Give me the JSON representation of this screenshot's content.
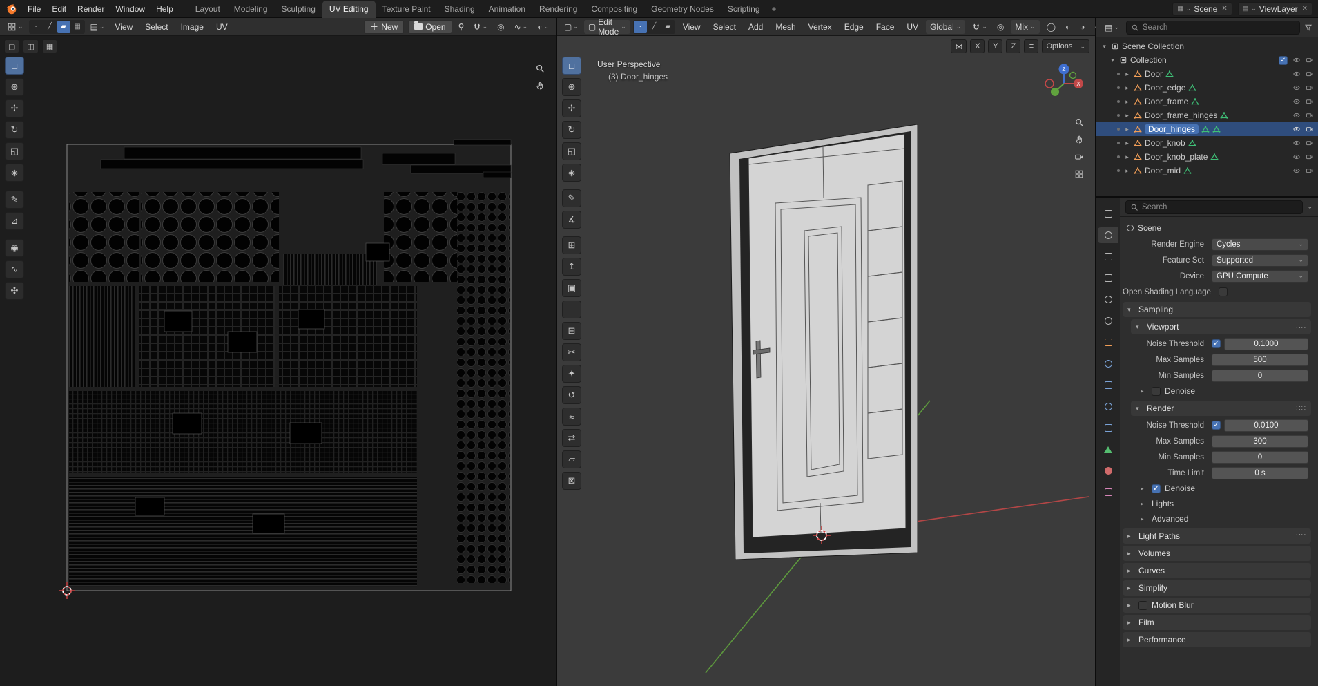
{
  "icons": {
    "caret": "⌄",
    "chevron_right": "▸",
    "chevron_down": "▾",
    "close": "✕",
    "plus": "＋",
    "grip": "∷∷",
    "cube": "▢",
    "proportional": "◎",
    "falloff": "∿",
    "overlay": "◐",
    "grid": "▦",
    "layers": "▤",
    "mirror": "⋈",
    "tool_options": "≡",
    "shading": [
      "◯",
      "◐",
      "◑",
      "●"
    ]
  },
  "colors": {
    "accent": "#4772b3",
    "selected_row": "#2f4d7d",
    "mesh_icon": "#ef9d57",
    "data_icon": "#3fbf77",
    "axis_x": "#c24848",
    "axis_y": "#61a33e",
    "axis_z": "#3f6fd0"
  },
  "topbar": {
    "menus": [
      "File",
      "Edit",
      "Render",
      "Window",
      "Help"
    ],
    "tabs": [
      "Layout",
      "Modeling",
      "Sculpting",
      "UV Editing",
      "Texture Paint",
      "Shading",
      "Animation",
      "Rendering",
      "Compositing",
      "Geometry Nodes",
      "Scripting"
    ],
    "active_tab": "UV Editing",
    "add_tab_label": "+",
    "scene_selector": {
      "label": "Scene"
    },
    "viewlayer_selector": {
      "label": "ViewLayer"
    }
  },
  "uv_editor": {
    "menus": [
      "View",
      "Select",
      "Image",
      "UV"
    ],
    "new_button_label": "New",
    "open_button_label": "Open",
    "mode_icons": [
      "∙",
      "╱",
      "▰",
      "▦"
    ],
    "settings_icons": [
      "▢",
      "◫",
      "▦"
    ],
    "tools": [
      {
        "name": "select-box",
        "glyph": "□"
      },
      {
        "name": "cursor",
        "glyph": "⊕"
      },
      {
        "name": "move",
        "glyph": "✢"
      },
      {
        "name": "rotate",
        "glyph": "↻"
      },
      {
        "name": "scale",
        "glyph": "◱"
      },
      {
        "name": "transform",
        "glyph": "◈"
      },
      {
        "name": "annotate",
        "glyph": "✎"
      },
      {
        "name": "rip",
        "glyph": "⊿"
      },
      {
        "name": "grab",
        "glyph": "◉"
      },
      {
        "name": "relax",
        "glyph": "∿"
      },
      {
        "name": "pinch",
        "glyph": "✣"
      }
    ]
  },
  "viewport": {
    "mode_label": "Edit Mode",
    "menus": [
      "View",
      "Select",
      "Add",
      "Mesh",
      "Vertex",
      "Edge",
      "Face",
      "UV"
    ],
    "mode_icons": [
      "∙",
      "╱",
      "▰"
    ],
    "orientation_label": "Global",
    "falloff_label": "Mix",
    "options_label": "Options",
    "mirror_axes": [
      "X",
      "Y",
      "Z"
    ],
    "view_label": "User Perspective",
    "object_label": "(3) Door_hinges",
    "axis_labels": {
      "x": "X",
      "z": "Z"
    },
    "tools": [
      {
        "name": "select-box",
        "glyph": "□"
      },
      {
        "name": "cursor",
        "glyph": "⊕"
      },
      {
        "name": "move",
        "glyph": "✢"
      },
      {
        "name": "rotate",
        "glyph": "↻"
      },
      {
        "name": "scale",
        "glyph": "◱"
      },
      {
        "name": "transform",
        "glyph": "◈"
      },
      {
        "name": "annotate",
        "glyph": "✎"
      },
      {
        "name": "measure",
        "glyph": "∡"
      },
      {
        "name": "add-cube",
        "glyph": "⊞"
      },
      {
        "name": "extrude-region",
        "glyph": "↥"
      },
      {
        "name": "inset-faces",
        "glyph": "▣"
      },
      {
        "name": "bevel",
        "glyph": "◇"
      },
      {
        "name": "loop-cut",
        "glyph": "⊟"
      },
      {
        "name": "knife",
        "glyph": "✂"
      },
      {
        "name": "poly-build",
        "glyph": "✦"
      },
      {
        "name": "spin",
        "glyph": "↺"
      },
      {
        "name": "smooth",
        "glyph": "≈"
      },
      {
        "name": "edge-slide",
        "glyph": "⇄"
      },
      {
        "name": "shear",
        "glyph": "▱"
      },
      {
        "name": "rip-region",
        "glyph": "⊠"
      }
    ]
  },
  "outliner": {
    "search_placeholder": "Search",
    "scene_collection": "Scene Collection",
    "collection": "Collection",
    "items": [
      {
        "label": "Door"
      },
      {
        "label": "Door_edge"
      },
      {
        "label": "Door_frame"
      },
      {
        "label": "Door_frame_hinges"
      },
      {
        "label": "Door_hinges",
        "selected": true
      },
      {
        "label": "Door_knob"
      },
      {
        "label": "Door_knob_plate"
      },
      {
        "label": "Door_mid"
      }
    ],
    "selected_item": "Door_hinges"
  },
  "properties": {
    "search_placeholder": "Search",
    "breadcrumb": "Scene",
    "rows": {
      "render_engine": {
        "label": "Render Engine",
        "value": "Cycles"
      },
      "feature_set": {
        "label": "Feature Set",
        "value": "Supported"
      },
      "device": {
        "label": "Device",
        "value": "GPU Compute"
      },
      "osl": {
        "label": "Open Shading Language",
        "checked": false
      }
    },
    "sampling": {
      "title": "Sampling",
      "viewport": {
        "title": "Viewport",
        "noise_threshold": {
          "label": "Noise Threshold",
          "value": "0.1000",
          "checked": true
        },
        "max_samples": {
          "label": "Max Samples",
          "value": "500"
        },
        "min_samples": {
          "label": "Min Samples",
          "value": "0"
        },
        "denoise": {
          "label": "Denoise",
          "checked": false
        }
      },
      "render": {
        "title": "Render",
        "noise_threshold": {
          "label": "Noise Threshold",
          "value": "0.0100",
          "checked": true
        },
        "max_samples": {
          "label": "Max Samples",
          "value": "300"
        },
        "min_samples": {
          "label": "Min Samples",
          "value": "0"
        },
        "time_limit": {
          "label": "Time Limit",
          "value": "0 s"
        },
        "denoise": {
          "label": "Denoise",
          "checked": true
        }
      },
      "lights_label": "Lights",
      "advanced_label": "Advanced"
    },
    "panels": [
      {
        "label": "Light Paths"
      },
      {
        "label": "Volumes"
      },
      {
        "label": "Curves"
      },
      {
        "label": "Simplify"
      },
      {
        "label": "Motion Blur",
        "has_checkbox": true,
        "checked": false
      },
      {
        "label": "Film"
      },
      {
        "label": "Performance"
      }
    ],
    "tabs": [
      {
        "name": "tool"
      },
      {
        "name": "render",
        "active": true
      },
      {
        "name": "output"
      },
      {
        "name": "view-layer"
      },
      {
        "name": "scene"
      },
      {
        "name": "world"
      },
      {
        "name": "object"
      },
      {
        "name": "modifiers"
      },
      {
        "name": "particles"
      },
      {
        "name": "physics"
      },
      {
        "name": "constraints"
      },
      {
        "name": "object-data"
      },
      {
        "name": "material"
      },
      {
        "name": "texture"
      }
    ]
  }
}
